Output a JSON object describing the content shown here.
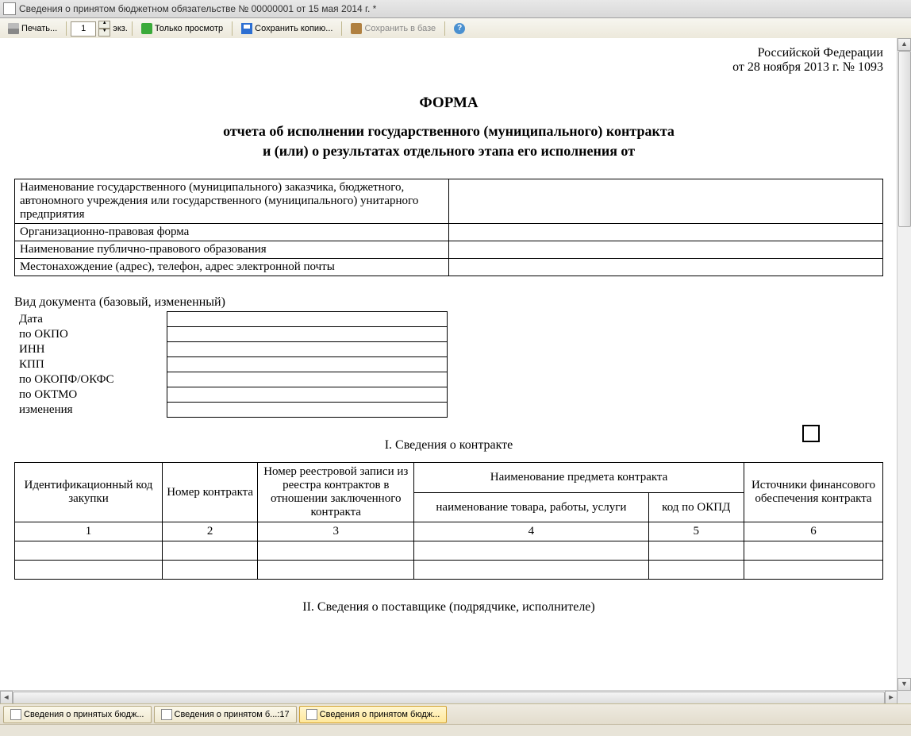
{
  "window_title": "Сведения о принятом бюджетном обязательстве № 00000001 от 15 мая 2014 г. *",
  "toolbar": {
    "print": "Печать...",
    "copies": "1",
    "copies_suffix": "экз.",
    "view_only": "Только просмотр",
    "save_copy": "Сохранить копию...",
    "save_db": "Сохранить в базе",
    "help": "?"
  },
  "header": {
    "line1": "Российской Федерации",
    "line2": "от 28 ноября 2013 г. № 1093"
  },
  "form": {
    "title": "ФОРМА",
    "sub1": "отчета об исполнении государственного (муниципального) контракта",
    "sub2": "и (или) о результатах отдельного этапа его исполнения от"
  },
  "t1": {
    "r1": "Наименование государственного (муниципального) заказчика, бюджетного, автономного учреждения или государственного (муниципального) унитарного предприятия",
    "r2": "Организационно-правовая форма",
    "r3": "Наименование публично-правового образования",
    "r4": "Местонахождение (адрес), телефон, адрес электронной почты"
  },
  "vid_doc": "Вид документа (базовый, измененный)",
  "t2": {
    "date": "Дата",
    "okpo": "по ОКПО",
    "inn": "ИНН",
    "kpp": "КПП",
    "okopf": "по ОКОПФ/ОКФС",
    "oktmo": "по ОКТМО",
    "izm": "изменения"
  },
  "sec1": "I. Сведения о контракте",
  "t3": {
    "h1": "Идентификационный код закупки",
    "h2": "Номер контракта",
    "h3": "Номер реестровой записи из реестра контрактов в отношении заключенного контракта",
    "h4": "Наименование предмета контракта",
    "h4a": "наименование товара, работы, услуги",
    "h4b": "код по ОКПД",
    "h5": "Источники финансового обеспечения контракта",
    "n1": "1",
    "n2": "2",
    "n3": "3",
    "n4": "4",
    "n5": "5",
    "n6": "6"
  },
  "sec2": "II. Сведения о поставщике (подрядчике, исполнителе)",
  "tabs": {
    "t1": "Сведения о принятых бюдж...",
    "t2": "Сведения о принятом б...:17",
    "t3": "Сведения о принятом бюдж..."
  }
}
